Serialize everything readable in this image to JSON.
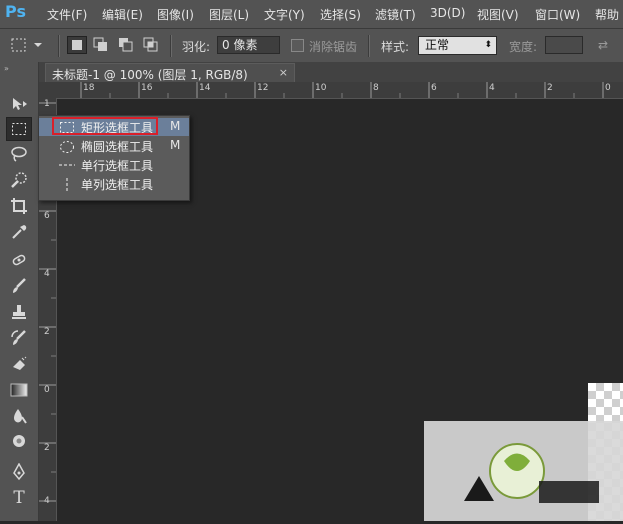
{
  "app": {
    "logo": "Ps"
  },
  "menubar": {
    "items": [
      "文件(F)",
      "编辑(E)",
      "图像(I)",
      "图层(L)",
      "文字(Y)",
      "选择(S)",
      "滤镜(T)",
      "3D(D)",
      "视图(V)",
      "窗口(W)",
      "帮助"
    ]
  },
  "options": {
    "feather_label": "羽化:",
    "feather_value": "0 像素",
    "antialias_label": "消除锯齿",
    "style_label": "样式:",
    "style_value": "正常",
    "width_label": "宽度:"
  },
  "document": {
    "tab_title": "未标题-1 @ 100% (图层 1, RGB/8)",
    "close": "×"
  },
  "ruler": {
    "top": [
      "18",
      "16",
      "14",
      "12",
      "10",
      "8",
      "6",
      "4",
      "2",
      "0"
    ],
    "left": [
      "1",
      "6",
      "4",
      "2",
      "0",
      "2",
      "4"
    ]
  },
  "flyout": {
    "items": [
      {
        "label": "矩形选框工具",
        "key": "M"
      },
      {
        "label": "椭圆选框工具",
        "key": "M"
      },
      {
        "label": "单行选框工具",
        "key": ""
      },
      {
        "label": "单列选框工具",
        "key": ""
      }
    ]
  },
  "colors": {
    "accent": "#4fb3f0",
    "highlight": "#d9202a",
    "selected": "#6b7f9a"
  },
  "tools": [
    "move-icon",
    "marquee-icon",
    "lasso-icon",
    "quick-select-icon",
    "crop-icon",
    "eyedropper-icon",
    "healing-icon",
    "brush-icon",
    "stamp-icon",
    "history-brush-icon",
    "eraser-icon",
    "gradient-icon",
    "blur-icon",
    "dodge-icon",
    "pen-icon",
    "type-icon"
  ]
}
